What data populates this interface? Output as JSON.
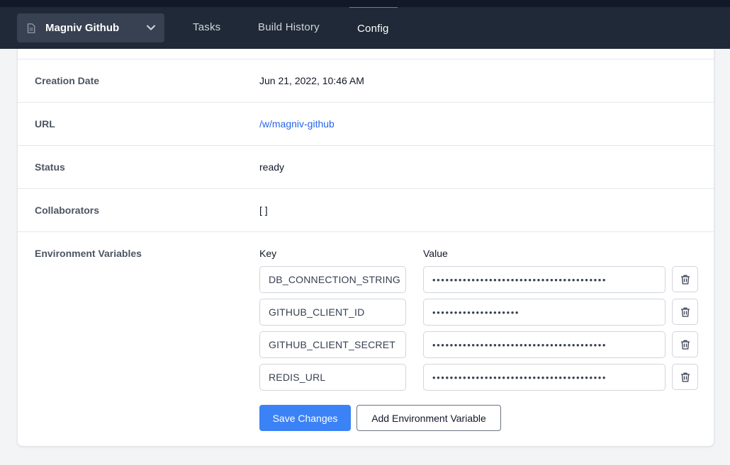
{
  "header": {
    "workspace_name": "Magniv Github",
    "tabs": [
      {
        "label": "Tasks"
      },
      {
        "label": "Build History"
      },
      {
        "label": "Config"
      }
    ]
  },
  "details": {
    "creation_date_label": "Creation Date",
    "creation_date_value": "Jun 21, 2022, 10:46 AM",
    "url_label": "URL",
    "url_value": "/w/magniv-github",
    "status_label": "Status",
    "status_value": "ready",
    "collaborators_label": "Collaborators",
    "collaborators_value": "[ ]",
    "env_label": "Environment Variables"
  },
  "env": {
    "key_header": "Key",
    "value_header": "Value",
    "rows": [
      {
        "key": "DB_CONNECTION_STRING",
        "value": "••••••••••••••••••••••••••••••••••••••••"
      },
      {
        "key": "GITHUB_CLIENT_ID",
        "value": "••••••••••••••••••••"
      },
      {
        "key": "GITHUB_CLIENT_SECRET",
        "value": "••••••••••••••••••••••••••••••••••••••••"
      },
      {
        "key": "REDIS_URL",
        "value": "••••••••••••••••••••••••••••••••••••••••"
      }
    ],
    "save_label": "Save Changes",
    "add_label": "Add Environment Variable"
  }
}
